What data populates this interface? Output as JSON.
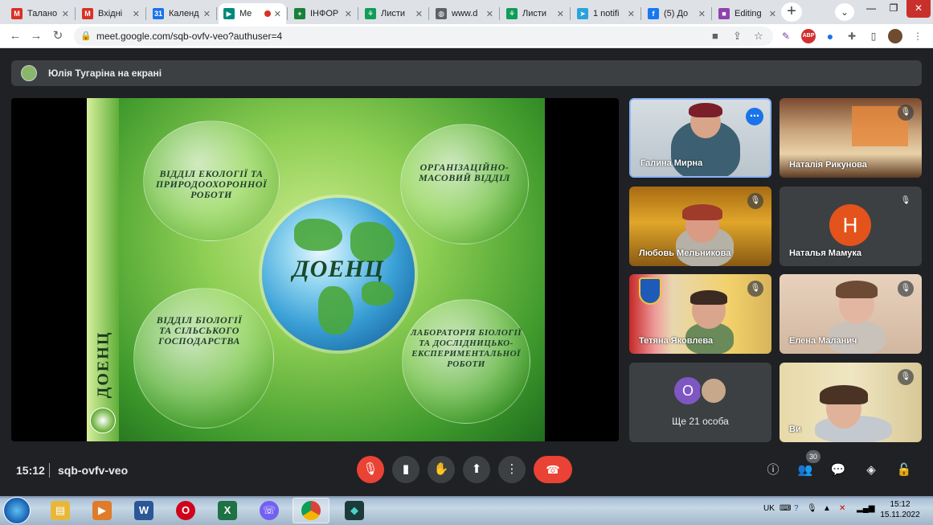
{
  "browser": {
    "tabs": [
      {
        "label": "Талано",
        "icon": "gmail-icon",
        "color": "#d93025",
        "glyph": "M"
      },
      {
        "label": "Вхідні",
        "icon": "gmail-icon",
        "color": "#d93025",
        "glyph": "M"
      },
      {
        "label": "Календ",
        "icon": "calendar-icon",
        "color": "#1a73e8",
        "glyph": "31"
      },
      {
        "label": "Me",
        "icon": "meet-icon",
        "color": "#00897b",
        "glyph": "▶",
        "active": true
      },
      {
        "label": "ІНФОР",
        "icon": "sheets-icon",
        "color": "#188038",
        "glyph": "+"
      },
      {
        "label": "Листи",
        "icon": "leaf-icon",
        "color": "#0f9d58",
        "glyph": "⚘"
      },
      {
        "label": "www.d",
        "icon": "globe-icon",
        "color": "#5f6368",
        "glyph": "◍"
      },
      {
        "label": "Листи",
        "icon": "leaf-icon",
        "color": "#0f9d58",
        "glyph": "⚘"
      },
      {
        "label": "1 notifi",
        "icon": "telegram-icon",
        "color": "#2aa3dc",
        "glyph": "➤"
      },
      {
        "label": "(5) Дo",
        "icon": "facebook-icon",
        "color": "#1877f2",
        "glyph": "f"
      },
      {
        "label": "Editing",
        "icon": "editing-icon",
        "color": "#8e44ad",
        "glyph": "■"
      }
    ],
    "url": "meet.google.com/sqb-ovfv-veo?authuser=4"
  },
  "meet": {
    "presenter_label": "Юлія Тугаріна на екрані",
    "slide": {
      "side_title": "ДОЕНЦ",
      "center_title": "ДОЕНЦ",
      "bubble_tl": "ВІДДІЛ ЕКОЛОГІЇ ТА ПРИРОДООХОРОННОЇ РОБОТИ",
      "bubble_tr": "ОРГАНІЗАЦІЙНО-МАСОВИЙ ВІДДІЛ",
      "bubble_bl": "ВІДДІЛ БІОЛОГІЇ ТА СІЛЬСЬКОГО ГОСПОДАРСТВА",
      "bubble_br": "ЛАБОРАТОРІЯ БІОЛОГІЇ ТА ДОСЛІДНИЦЬКО-ЕКСПЕРИМЕНТАЛЬНОЇ РОБОТИ"
    },
    "participants": [
      {
        "name": "Галина Мирна"
      },
      {
        "name": "Наталія Рикунова"
      },
      {
        "name": "Любовь Мельникова"
      },
      {
        "name": "Наталья Мамука",
        "initial": "Н"
      },
      {
        "name": "Тетяна Яковлева"
      },
      {
        "name": "Елена Маланич"
      },
      {
        "name": "Ви"
      }
    ],
    "others": {
      "label": "Ще 21 особа",
      "initial": "О"
    },
    "time": "15:12",
    "meeting_code": "sqb-ovfv-veo",
    "people_count": "30"
  },
  "taskbar": {
    "lang": "UK",
    "clock_time": "15:12",
    "clock_date": "15.11.2022"
  }
}
